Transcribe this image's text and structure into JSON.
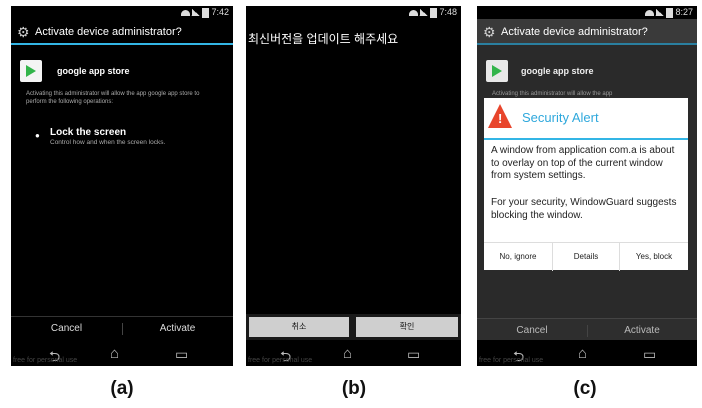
{
  "panel_a": {
    "status_time": "7:42",
    "title": "Activate device administrator?",
    "app_name": "google app store",
    "description": "Activating this administrator will allow the app google app store to perform the following operations:",
    "permission_title": "Lock the screen",
    "permission_desc": "Control how and when the screen locks.",
    "cancel_label": "Cancel",
    "activate_label": "Activate",
    "watermark": "free for personal use",
    "caption": "(a)"
  },
  "panel_b": {
    "status_time": "7:48",
    "message": "최신버전을 업데이트 해주세요",
    "cancel_label": "취소",
    "ok_label": "확인",
    "watermark": "free for personal use",
    "caption": "(b)"
  },
  "panel_c": {
    "status_time": "8:27",
    "title": "Activate device administrator?",
    "app_name": "google app store",
    "bg_text": "Activating this administrator will allow the app",
    "alert_title": "Security Alert",
    "alert_body_1": "A window from application com.a is about to overlay on top of the current window from system settings.",
    "alert_body_2": "For your security, WindowGuard suggests blocking the window.",
    "btn_ignore": "No, ignore",
    "btn_details": "Details",
    "btn_block": "Yes, block",
    "cancel_label": "Cancel",
    "activate_label": "Activate",
    "watermark": "free for personal use",
    "caption": "(c)"
  },
  "colors": {
    "accent": "#33b5e5",
    "alert_icon": "#e8452c",
    "alert_title": "#2fa8dc"
  }
}
